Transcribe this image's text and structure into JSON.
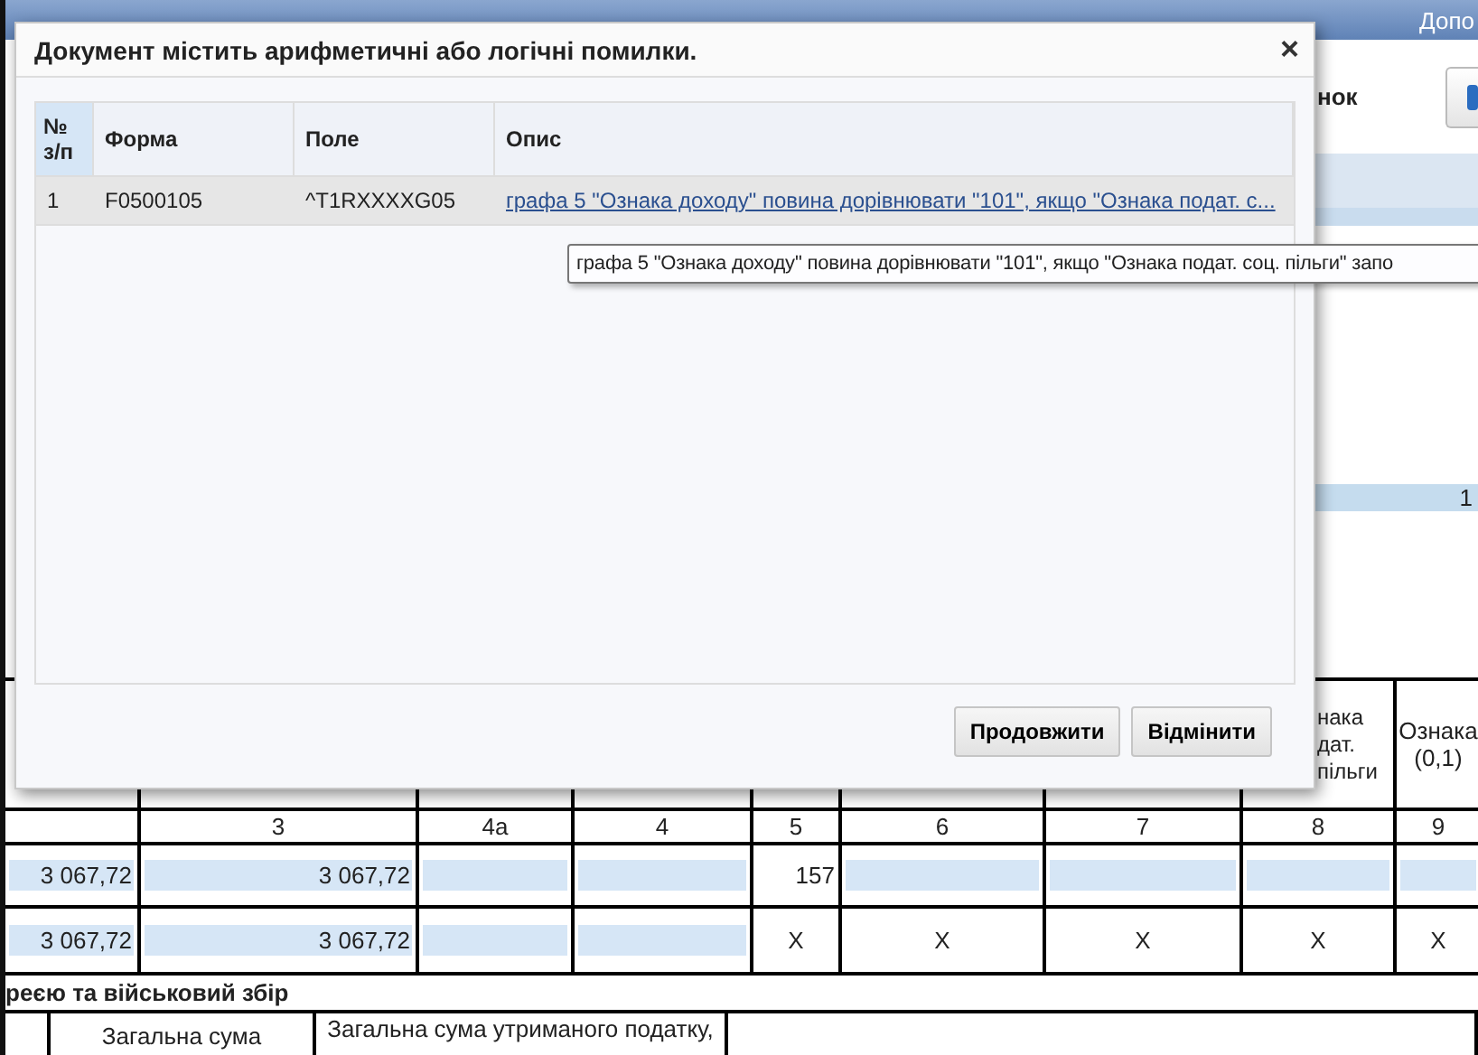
{
  "background": {
    "header_text": "Допо",
    "toolbar_text": "нок",
    "band_value": "1",
    "table": {
      "header": [
        {
          "text": "нака дат. пільги"
        },
        {
          "text": "Ознака (0,1)"
        }
      ],
      "numbers": [
        "3",
        "4а",
        "4",
        "5",
        "6",
        "7",
        "8",
        "9"
      ],
      "rows": [
        [
          {
            "kind": "field",
            "value": "3 067,72"
          },
          {
            "kind": "field",
            "value": "3 067,72"
          },
          {
            "kind": "field"
          },
          {
            "kind": "field"
          },
          {
            "kind": "number",
            "value": "157"
          },
          {
            "kind": "field"
          },
          {
            "kind": "field"
          },
          {
            "kind": "field"
          },
          {
            "kind": "field"
          }
        ],
        [
          {
            "kind": "field",
            "value": "3 067,72"
          },
          {
            "kind": "field",
            "value": "3 067,72"
          },
          {
            "kind": "field"
          },
          {
            "kind": "field"
          },
          {
            "kind": "text",
            "value": "X"
          },
          {
            "kind": "text",
            "value": "X"
          },
          {
            "kind": "text",
            "value": "X"
          },
          {
            "kind": "text",
            "value": "X"
          },
          {
            "kind": "text",
            "value": "X"
          }
        ]
      ],
      "section_title": "реєю та військовий збір",
      "subheader": [
        "Загальна сума",
        "Загальна сума утриманого податку,"
      ]
    }
  },
  "dialog": {
    "title": "Документ містить арифметичні або логічні помилки.",
    "close": "×",
    "columns": [
      "№ з/п",
      "Форма",
      "Поле",
      "Опис"
    ],
    "rows": [
      {
        "cells": [
          "1",
          "F0500105",
          "^T1RXXXXG05"
        ],
        "description": "графа 5 \"Ознака доходу\" повина дорівнювати \"101\", якщо \"Ознака подат. с...",
        "selected": true
      }
    ],
    "tooltip": "графа 5 \"Ознака доходу\" повина дорівнювати \"101\", якщо \"Ознака подат. соц. пільги\" запо",
    "buttons": [
      "Продовжити",
      "Відмінити"
    ]
  }
}
